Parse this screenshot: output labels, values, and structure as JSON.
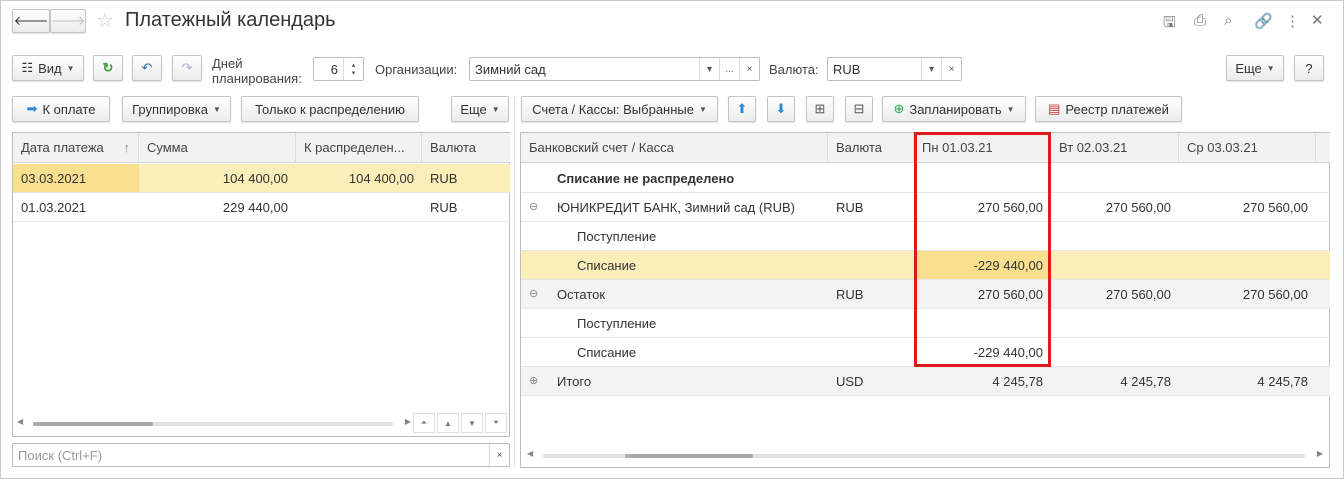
{
  "title": "Платежный календарь",
  "toolbar": {
    "view": "Вид",
    "days_label": "Дней планирования:",
    "days_value": "6",
    "org_label": "Организации:",
    "org_value": "Зимний сад",
    "currency_label": "Валюта:",
    "currency_value": "RUB",
    "more": "Еще",
    "help": "?",
    "select_btn": "...",
    "clear": "×"
  },
  "left": {
    "pay_btn": "К оплате",
    "group_btn": "Группировка",
    "only_btn": "Только к распределению",
    "more": "Еще",
    "columns": [
      "Дата платежа",
      "Сумма",
      "К распределен...",
      "Валюта"
    ],
    "rows": [
      {
        "date": "03.03.2021",
        "sum": "104 400,00",
        "dist": "104 400,00",
        "cur": "RUB"
      },
      {
        "date": "01.03.2021",
        "sum": "229 440,00",
        "dist": "",
        "cur": "RUB"
      }
    ],
    "search_placeholder": "Поиск (Ctrl+F)"
  },
  "right": {
    "accounts_btn": "Счета / Кассы: Выбранные",
    "plan_btn": "Запланировать",
    "registry_btn": "Реестр платежей",
    "columns": [
      "Банковский счет / Касса",
      "Валюта",
      "Пн 01.03.21",
      "Вт 02.03.21",
      "Ср 03.03.21"
    ],
    "rows": [
      {
        "name": "Списание не распределено",
        "cur": "",
        "d1": "",
        "d2": "",
        "d3": ""
      },
      {
        "name": "ЮНИКРЕДИТ БАНК, Зимний сад (RUB)",
        "cur": "RUB",
        "d1": "270 560,00",
        "d2": "270 560,00",
        "d3": "270 560,00"
      },
      {
        "name": "Поступление",
        "cur": "",
        "d1": "",
        "d2": "",
        "d3": ""
      },
      {
        "name": "Списание",
        "cur": "",
        "d1": "-229 440,00",
        "d2": "",
        "d3": ""
      },
      {
        "name": "Остаток",
        "cur": "RUB",
        "d1": "270 560,00",
        "d2": "270 560,00",
        "d3": "270 560,00"
      },
      {
        "name": "Поступление",
        "cur": "",
        "d1": "",
        "d2": "",
        "d3": ""
      },
      {
        "name": "Списание",
        "cur": "",
        "d1": "-229 440,00",
        "d2": "",
        "d3": ""
      },
      {
        "name": "Итого",
        "cur": "USD",
        "d1": "4 245,78",
        "d2": "4 245,78",
        "d3": "4 245,78"
      }
    ]
  }
}
